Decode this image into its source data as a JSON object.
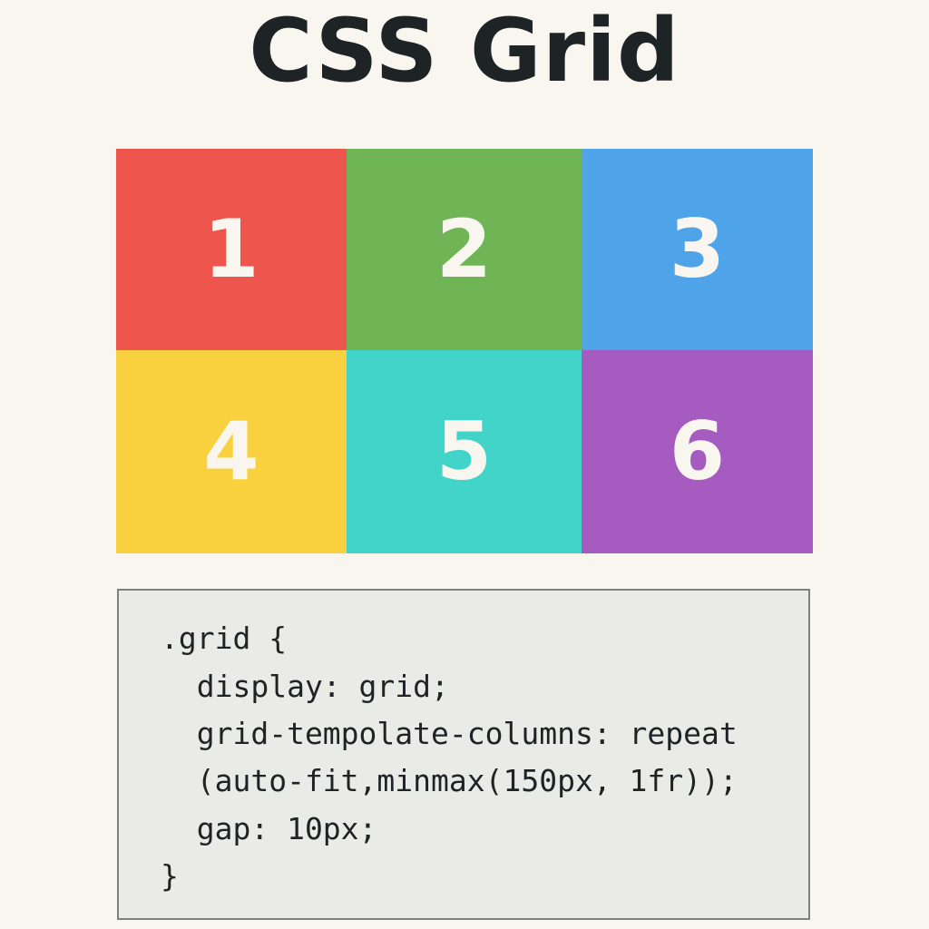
{
  "page": {
    "title": "CSS Grid",
    "background": "#f9f6f0"
  },
  "grid_demo": {
    "cells": [
      {
        "label": "1",
        "color": "#ee554d"
      },
      {
        "label": "2",
        "color": "#6fb556"
      },
      {
        "label": "3",
        "color": "#4fa4e9"
      },
      {
        "label": "4",
        "color": "#f9d03d"
      },
      {
        "label": "5",
        "color": "#42d3c9"
      },
      {
        "label": "6",
        "color": "#a55bc0"
      }
    ]
  },
  "code_panel": {
    "background": "#eaeae6",
    "lines": [
      ".grid {",
      "  display: grid;",
      "  grid-tempolate-columns: repeat",
      "  (auto-fit,minmax(150px, 1fr));",
      "  gap: 10px;",
      "}"
    ]
  }
}
